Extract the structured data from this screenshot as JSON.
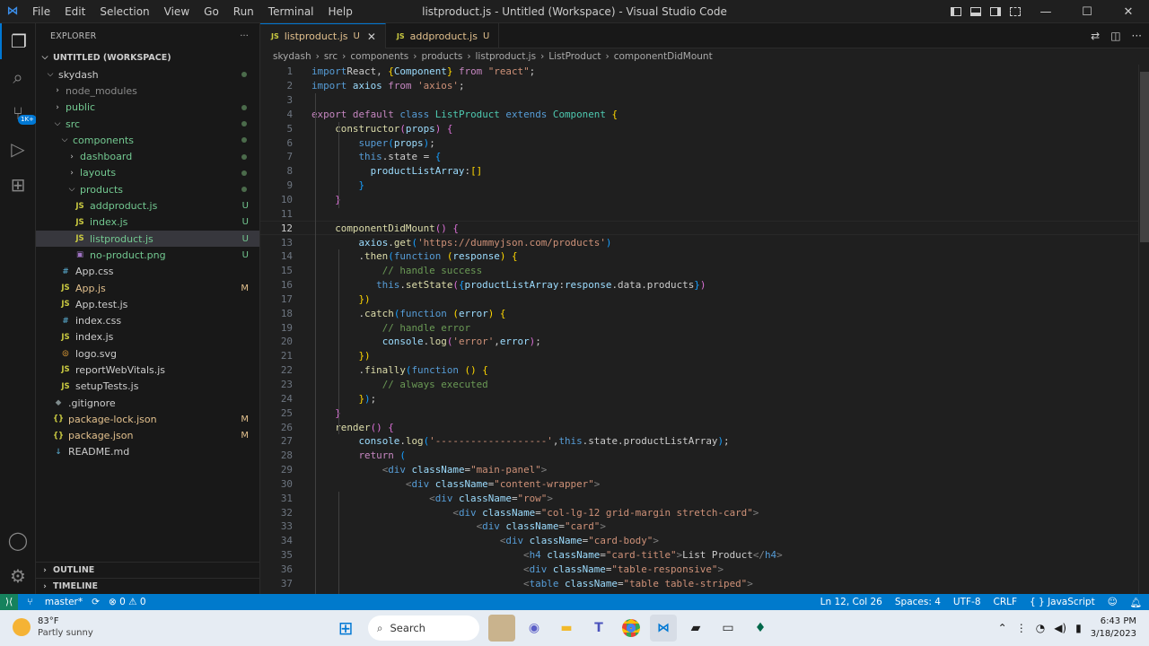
{
  "titlebar": {
    "menu": [
      "File",
      "Edit",
      "Selection",
      "View",
      "Go",
      "Run",
      "Terminal",
      "Help"
    ],
    "title": "listproduct.js - Untitled (Workspace) - Visual Studio Code"
  },
  "activity": {
    "badge": "1K+"
  },
  "explorer": {
    "header": "EXPLORER",
    "more": "···",
    "workspace": "UNTITLED (WORKSPACE)",
    "items": [
      {
        "label": "skydash",
        "indent": 0,
        "kind": "folder-open",
        "status": "dot",
        "color": "norm"
      },
      {
        "label": "node_modules",
        "indent": 1,
        "kind": "folder",
        "status": "",
        "color": "dim"
      },
      {
        "label": "public",
        "indent": 1,
        "kind": "folder",
        "status": "dot",
        "color": "green"
      },
      {
        "label": "src",
        "indent": 1,
        "kind": "folder-open",
        "status": "dot",
        "color": "green"
      },
      {
        "label": "components",
        "indent": 2,
        "kind": "folder-open",
        "status": "dot",
        "color": "green"
      },
      {
        "label": "dashboard",
        "indent": 3,
        "kind": "folder",
        "status": "dot",
        "color": "green"
      },
      {
        "label": "layouts",
        "indent": 3,
        "kind": "folder",
        "status": "dot",
        "color": "green"
      },
      {
        "label": "products",
        "indent": 3,
        "kind": "folder-open",
        "status": "dot",
        "color": "green"
      },
      {
        "label": "addproduct.js",
        "indent": 4,
        "kind": "js",
        "status": "U",
        "color": "green"
      },
      {
        "label": "index.js",
        "indent": 4,
        "kind": "js",
        "status": "U",
        "color": "green"
      },
      {
        "label": "listproduct.js",
        "indent": 4,
        "kind": "js",
        "status": "U",
        "color": "green",
        "selected": true
      },
      {
        "label": "no-product.png",
        "indent": 4,
        "kind": "img",
        "status": "U",
        "color": "green"
      },
      {
        "label": "App.css",
        "indent": 2,
        "kind": "css",
        "status": "",
        "color": "norm"
      },
      {
        "label": "App.js",
        "indent": 2,
        "kind": "js",
        "status": "M",
        "color": "yel"
      },
      {
        "label": "App.test.js",
        "indent": 2,
        "kind": "js",
        "status": "",
        "color": "norm"
      },
      {
        "label": "index.css",
        "indent": 2,
        "kind": "css",
        "status": "",
        "color": "norm"
      },
      {
        "label": "index.js",
        "indent": 2,
        "kind": "js",
        "status": "",
        "color": "norm"
      },
      {
        "label": "logo.svg",
        "indent": 2,
        "kind": "svg",
        "status": "",
        "color": "norm"
      },
      {
        "label": "reportWebVitals.js",
        "indent": 2,
        "kind": "js",
        "status": "",
        "color": "norm"
      },
      {
        "label": "setupTests.js",
        "indent": 2,
        "kind": "js",
        "status": "",
        "color": "norm"
      },
      {
        "label": ".gitignore",
        "indent": 1,
        "kind": "git",
        "status": "",
        "color": "norm"
      },
      {
        "label": "package-lock.json",
        "indent": 1,
        "kind": "json",
        "status": "M",
        "color": "yel"
      },
      {
        "label": "package.json",
        "indent": 1,
        "kind": "json",
        "status": "M",
        "color": "yel"
      },
      {
        "label": "README.md",
        "indent": 1,
        "kind": "md",
        "status": "",
        "color": "norm"
      }
    ],
    "outline": "OUTLINE",
    "timeline": "TIMELINE"
  },
  "tabs": [
    {
      "label": "listproduct.js",
      "status": "U",
      "active": true
    },
    {
      "label": "addproduct.js",
      "status": "U",
      "active": false
    }
  ],
  "breadcrumb": [
    "skydash",
    "src",
    "components",
    "products",
    "listproduct.js",
    "ListProduct",
    "componentDidMount"
  ],
  "code": {
    "current_line": 12,
    "lines": [
      [
        [
          "k",
          "import"
        ],
        [
          "",
          "React, "
        ],
        [
          "br",
          "{"
        ],
        [
          "v",
          "Component"
        ],
        [
          "br",
          "}"
        ],
        [
          "",
          " "
        ],
        [
          "kc",
          "from"
        ],
        [
          "",
          " "
        ],
        [
          "s",
          "\"react\""
        ],
        [
          "",
          ";"
        ]
      ],
      [
        [
          "k",
          "import"
        ],
        [
          "",
          " "
        ],
        [
          "v",
          "axios"
        ],
        [
          "",
          " "
        ],
        [
          "kc",
          "from"
        ],
        [
          "",
          " "
        ],
        [
          "s",
          "'axios'"
        ],
        [
          "",
          ";"
        ]
      ],
      [],
      [
        [
          "kc",
          "export"
        ],
        [
          "",
          " "
        ],
        [
          "kc",
          "default"
        ],
        [
          "",
          " "
        ],
        [
          "k",
          "class"
        ],
        [
          "",
          " "
        ],
        [
          "cl",
          "ListProduct"
        ],
        [
          "",
          " "
        ],
        [
          "k",
          "extends"
        ],
        [
          "",
          " "
        ],
        [
          "cl",
          "Component"
        ],
        [
          "",
          " "
        ],
        [
          "br",
          "{"
        ]
      ],
      [
        [
          "",
          "    "
        ],
        [
          "fn",
          "constructor"
        ],
        [
          "br2",
          "("
        ],
        [
          "v",
          "props"
        ],
        [
          "br2",
          ")"
        ],
        [
          "",
          " "
        ],
        [
          "br2",
          "{"
        ]
      ],
      [
        [
          "",
          "        "
        ],
        [
          "k",
          "super"
        ],
        [
          "br3",
          "("
        ],
        [
          "v",
          "props"
        ],
        [
          "br3",
          ")"
        ],
        [
          "",
          ";"
        ]
      ],
      [
        [
          "",
          "        "
        ],
        [
          "k",
          "this"
        ],
        [
          "",
          ".state = "
        ],
        [
          "br3",
          "{"
        ]
      ],
      [
        [
          "",
          "          "
        ],
        [
          "v",
          "productListArray"
        ],
        [
          "",
          ":"
        ],
        [
          "br",
          "[]"
        ]
      ],
      [
        [
          "",
          "        "
        ],
        [
          "br3",
          "}"
        ]
      ],
      [
        [
          "",
          "    "
        ],
        [
          "br2",
          "}"
        ]
      ],
      [],
      [
        [
          "",
          "    "
        ],
        [
          "fn",
          "componentDidMount"
        ],
        [
          "br2",
          "()"
        ],
        [
          "",
          " "
        ],
        [
          "br2",
          "{"
        ]
      ],
      [
        [
          "",
          "        "
        ],
        [
          "v",
          "axios"
        ],
        [
          "",
          "."
        ],
        [
          "fn",
          "get"
        ],
        [
          "br3",
          "("
        ],
        [
          "s",
          "'https://dummyjson.com/products'"
        ],
        [
          "br3",
          ")"
        ]
      ],
      [
        [
          "",
          "        ."
        ],
        [
          "fn",
          "then"
        ],
        [
          "br3",
          "("
        ],
        [
          "k",
          "function"
        ],
        [
          "",
          " "
        ],
        [
          "br",
          "("
        ],
        [
          "v",
          "response"
        ],
        [
          "br",
          ")"
        ],
        [
          "",
          " "
        ],
        [
          "br",
          "{"
        ]
      ],
      [
        [
          "",
          "            "
        ],
        [
          "cm",
          "// handle success"
        ]
      ],
      [
        [
          "",
          "           "
        ],
        [
          "k",
          "this"
        ],
        [
          "",
          "."
        ],
        [
          "fn",
          "setState"
        ],
        [
          "br2",
          "("
        ],
        [
          "br3",
          "{"
        ],
        [
          "v",
          "productListArray"
        ],
        [
          "",
          ":"
        ],
        [
          "v",
          "response"
        ],
        [
          "",
          ".data.products"
        ],
        [
          "br3",
          "}"
        ],
        [
          "br2",
          ")"
        ]
      ],
      [
        [
          "",
          "        "
        ],
        [
          "br",
          "})"
        ]
      ],
      [
        [
          "",
          "        ."
        ],
        [
          "fn",
          "catch"
        ],
        [
          "br3",
          "("
        ],
        [
          "k",
          "function"
        ],
        [
          "",
          " "
        ],
        [
          "br",
          "("
        ],
        [
          "v",
          "error"
        ],
        [
          "br",
          ")"
        ],
        [
          "",
          " "
        ],
        [
          "br",
          "{"
        ]
      ],
      [
        [
          "",
          "            "
        ],
        [
          "cm",
          "// handle error"
        ]
      ],
      [
        [
          "",
          "            "
        ],
        [
          "v",
          "console"
        ],
        [
          "",
          "."
        ],
        [
          "fn",
          "log"
        ],
        [
          "br2",
          "("
        ],
        [
          "s",
          "'error'"
        ],
        [
          "",
          ","
        ],
        [
          "v",
          "error"
        ],
        [
          "br2",
          ")"
        ],
        [
          "",
          ";"
        ]
      ],
      [
        [
          "",
          "        "
        ],
        [
          "br",
          "})"
        ]
      ],
      [
        [
          "",
          "        ."
        ],
        [
          "fn",
          "finally"
        ],
        [
          "br3",
          "("
        ],
        [
          "k",
          "function"
        ],
        [
          "",
          " "
        ],
        [
          "br",
          "()"
        ],
        [
          "",
          " "
        ],
        [
          "br",
          "{"
        ]
      ],
      [
        [
          "",
          "            "
        ],
        [
          "cm",
          "// always executed"
        ]
      ],
      [
        [
          "",
          "        "
        ],
        [
          "br",
          "}"
        ],
        [
          "br3",
          ")"
        ],
        [
          "",
          ";"
        ]
      ],
      [
        [
          "",
          "    "
        ],
        [
          "br2",
          "}"
        ]
      ],
      [
        [
          "",
          "    "
        ],
        [
          "fn",
          "render"
        ],
        [
          "br2",
          "()"
        ],
        [
          "",
          " "
        ],
        [
          "br2",
          "{"
        ]
      ],
      [
        [
          "",
          "        "
        ],
        [
          "v",
          "console"
        ],
        [
          "",
          "."
        ],
        [
          "fn",
          "log"
        ],
        [
          "br3",
          "("
        ],
        [
          "s",
          "'-------------------'"
        ],
        [
          "",
          ","
        ],
        [
          "k",
          "this"
        ],
        [
          "",
          ".state.productListArray"
        ],
        [
          "br3",
          ")"
        ],
        [
          "",
          ";"
        ]
      ],
      [
        [
          "",
          "        "
        ],
        [
          "kc",
          "return"
        ],
        [
          "",
          " "
        ],
        [
          "br3",
          "("
        ]
      ],
      [
        [
          "",
          "            "
        ],
        [
          "pu",
          "<"
        ],
        [
          "t",
          "div"
        ],
        [
          "",
          " "
        ],
        [
          "at",
          "className"
        ],
        [
          "",
          "="
        ],
        [
          "s",
          "\"main-panel\""
        ],
        [
          "pu",
          ">"
        ]
      ],
      [
        [
          "",
          "                "
        ],
        [
          "pu",
          "<"
        ],
        [
          "t",
          "div"
        ],
        [
          "",
          " "
        ],
        [
          "at",
          "className"
        ],
        [
          "",
          "="
        ],
        [
          "s",
          "\"content-wrapper\""
        ],
        [
          "pu",
          ">"
        ]
      ],
      [
        [
          "",
          "                    "
        ],
        [
          "pu",
          "<"
        ],
        [
          "t",
          "div"
        ],
        [
          "",
          " "
        ],
        [
          "at",
          "className"
        ],
        [
          "",
          "="
        ],
        [
          "s",
          "\"row\""
        ],
        [
          "pu",
          ">"
        ]
      ],
      [
        [
          "",
          "                        "
        ],
        [
          "pu",
          "<"
        ],
        [
          "t",
          "div"
        ],
        [
          "",
          " "
        ],
        [
          "at",
          "className"
        ],
        [
          "",
          "="
        ],
        [
          "s",
          "\"col-lg-12 grid-margin stretch-card\""
        ],
        [
          "pu",
          ">"
        ]
      ],
      [
        [
          "",
          "                            "
        ],
        [
          "pu",
          "<"
        ],
        [
          "t",
          "div"
        ],
        [
          "",
          " "
        ],
        [
          "at",
          "className"
        ],
        [
          "",
          "="
        ],
        [
          "s",
          "\"card\""
        ],
        [
          "pu",
          ">"
        ]
      ],
      [
        [
          "",
          "                                "
        ],
        [
          "pu",
          "<"
        ],
        [
          "t",
          "div"
        ],
        [
          "",
          " "
        ],
        [
          "at",
          "className"
        ],
        [
          "",
          "="
        ],
        [
          "s",
          "\"card-body\""
        ],
        [
          "pu",
          ">"
        ]
      ],
      [
        [
          "",
          "                                    "
        ],
        [
          "pu",
          "<"
        ],
        [
          "t",
          "h4"
        ],
        [
          "",
          " "
        ],
        [
          "at",
          "className"
        ],
        [
          "",
          "="
        ],
        [
          "s",
          "\"card-title\""
        ],
        [
          "pu",
          ">"
        ],
        [
          "",
          "List Product"
        ],
        [
          "pu",
          "</"
        ],
        [
          "t",
          "h4"
        ],
        [
          "pu",
          ">"
        ]
      ],
      [
        [
          "",
          "                                    "
        ],
        [
          "pu",
          "<"
        ],
        [
          "t",
          "div"
        ],
        [
          "",
          " "
        ],
        [
          "at",
          "className"
        ],
        [
          "",
          "="
        ],
        [
          "s",
          "\"table-responsive\""
        ],
        [
          "pu",
          ">"
        ]
      ],
      [
        [
          "",
          "                                    "
        ],
        [
          "pu",
          "<"
        ],
        [
          "t",
          "table"
        ],
        [
          "",
          " "
        ],
        [
          "at",
          "className"
        ],
        [
          "",
          "="
        ],
        [
          "s",
          "\"table table-striped\""
        ],
        [
          "pu",
          ">"
        ]
      ]
    ]
  },
  "status": {
    "branch": "master*",
    "errors": "⊗ 0 ⚠ 0",
    "position": "Ln 12, Col 26",
    "spaces": "Spaces: 4",
    "encoding": "UTF-8",
    "eol": "CRLF",
    "language": "{ } JavaScript"
  },
  "taskbar": {
    "temp": "83°F",
    "weather": "Partly sunny",
    "search": "Search",
    "time": "6:43 PM",
    "date": "3/18/2023"
  }
}
